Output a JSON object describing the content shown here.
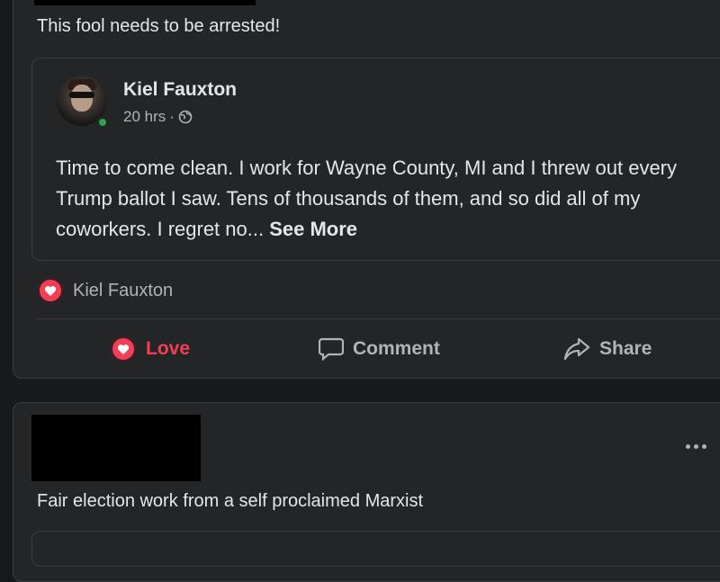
{
  "post1": {
    "text": "This fool needs to be arrested!",
    "shared": {
      "author": "Kiel Fauxton",
      "time": "20 hrs",
      "separator": "·",
      "audience_icon": "globe-icon",
      "body": "Time to come clean. I work for Wayne County, MI and I threw out every Trump ballot I saw. Tens of thousands of them, and so did all of my coworkers. I regret no...",
      "see_more": "See More"
    },
    "reaction": {
      "icon": "love-reaction-icon",
      "name": "Kiel Fauxton"
    },
    "actions": {
      "love": "Love",
      "comment": "Comment",
      "share": "Share"
    }
  },
  "post2": {
    "text": "Fair election work from a self proclaimed Marxist",
    "more_icon": "more-options-icon"
  },
  "colors": {
    "background": "#18191a",
    "card": "#242526",
    "love": "#f33e58",
    "online": "#31a24c",
    "muted": "#b0b3b8"
  }
}
